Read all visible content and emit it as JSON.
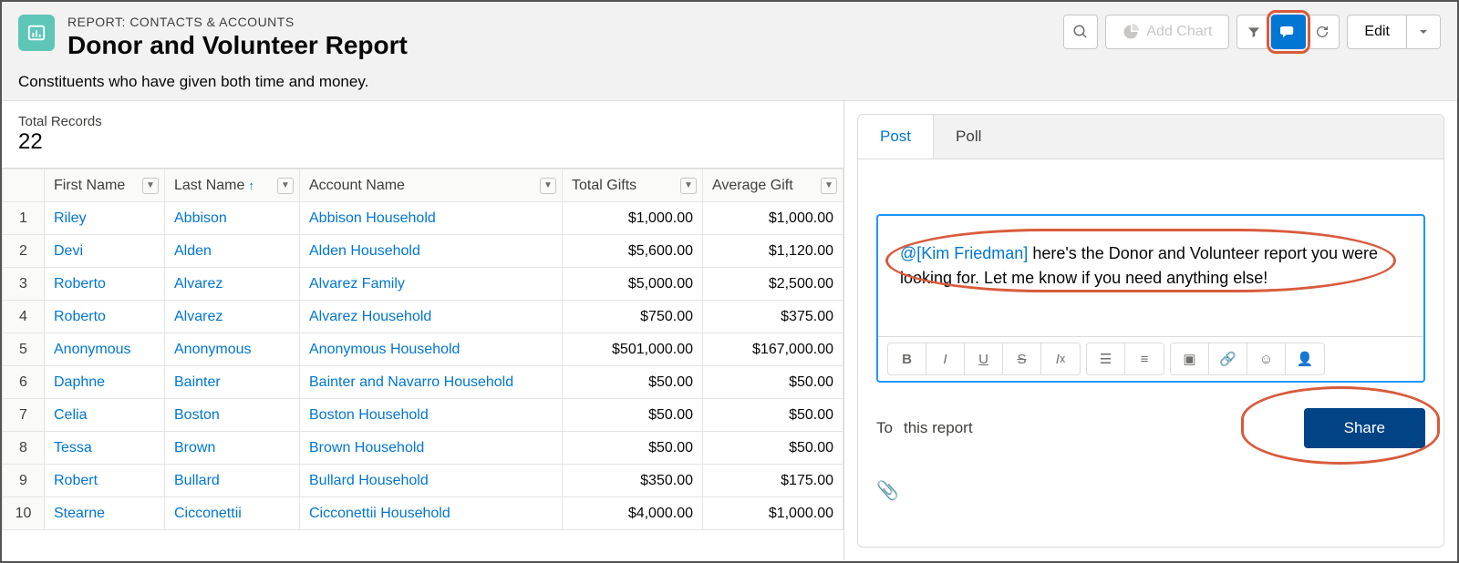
{
  "header": {
    "eyebrow": "REPORT: CONTACTS & ACCOUNTS",
    "title": "Donor and Volunteer Report",
    "description": "Constituents who have given both time and money.",
    "add_chart_label": "Add Chart",
    "edit_label": "Edit"
  },
  "summary": {
    "label": "Total Records",
    "value": "22"
  },
  "columns": {
    "first": "First Name",
    "last": "Last Name",
    "account": "Account Name",
    "total_gifts": "Total Gifts",
    "avg_gift": "Average Gift"
  },
  "rows": [
    {
      "n": "1",
      "first": "Riley",
      "last": "Abbison",
      "acct": "Abbison Household",
      "total": "$1,000.00",
      "avg": "$1,000.00"
    },
    {
      "n": "2",
      "first": "Devi",
      "last": "Alden",
      "acct": "Alden Household",
      "total": "$5,600.00",
      "avg": "$1,120.00"
    },
    {
      "n": "3",
      "first": "Roberto",
      "last": "Alvarez",
      "acct": "Alvarez Family",
      "total": "$5,000.00",
      "avg": "$2,500.00"
    },
    {
      "n": "4",
      "first": "Roberto",
      "last": "Alvarez",
      "acct": "Alvarez Household",
      "total": "$750.00",
      "avg": "$375.00"
    },
    {
      "n": "5",
      "first": "Anonymous",
      "last": "Anonymous",
      "acct": "Anonymous Household",
      "total": "$501,000.00",
      "avg": "$167,000.00"
    },
    {
      "n": "6",
      "first": "Daphne",
      "last": "Bainter",
      "acct": "Bainter and Navarro Household",
      "total": "$50.00",
      "avg": "$50.00"
    },
    {
      "n": "7",
      "first": "Celia",
      "last": "Boston",
      "acct": "Boston Household",
      "total": "$50.00",
      "avg": "$50.00"
    },
    {
      "n": "8",
      "first": "Tessa",
      "last": "Brown",
      "acct": "Brown Household",
      "total": "$50.00",
      "avg": "$50.00"
    },
    {
      "n": "9",
      "first": "Robert",
      "last": "Bullard",
      "acct": "Bullard Household",
      "total": "$350.00",
      "avg": "$175.00"
    },
    {
      "n": "10",
      "first": "Stearne",
      "last": "Cicconettii",
      "acct": "Cicconettii Household",
      "total": "$4,000.00",
      "avg": "$1,000.00"
    }
  ],
  "feed": {
    "tabs": {
      "post": "Post",
      "poll": "Poll"
    },
    "mention": "@[Kim Friedman]",
    "body": " here's the Donor and Volunteer   report you were looking for. Let me know if you need anything else!",
    "to_label": "To",
    "to_value": "this report",
    "share_label": "Share"
  }
}
